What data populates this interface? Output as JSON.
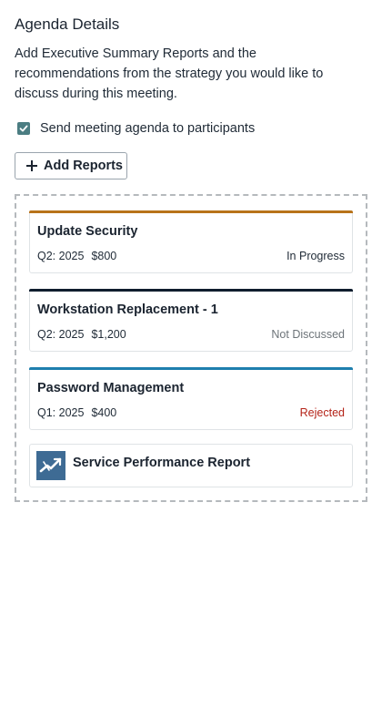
{
  "panel": {
    "title": "Agenda Details",
    "description": "Add Executive Summary Reports and the recommendations from the strategy you would like to discuss during this meeting.",
    "send_agenda_label": "Send meeting agenda to participants",
    "send_agenda_checked": true,
    "add_reports_label": "Add Reports"
  },
  "cards": [
    {
      "title": "Update Security",
      "quarter": "Q2: 2025",
      "amount": "$800",
      "status": "In Progress",
      "accent": "#b8731a"
    },
    {
      "title": "Workstation Replacement - 1",
      "quarter": "Q2: 2025",
      "amount": "$1,200",
      "status": "Not Discussed",
      "accent": "#0f1d2e"
    },
    {
      "title": "Password Management",
      "quarter": "Q1: 2025",
      "amount": "$400",
      "status": "Rejected",
      "accent": "#1f7fae"
    }
  ],
  "report": {
    "title": "Service Performance Report",
    "logo_color": "#3e6b94"
  },
  "colors": {
    "checkbox": "#4b7d82",
    "rejected": "#b42318"
  }
}
